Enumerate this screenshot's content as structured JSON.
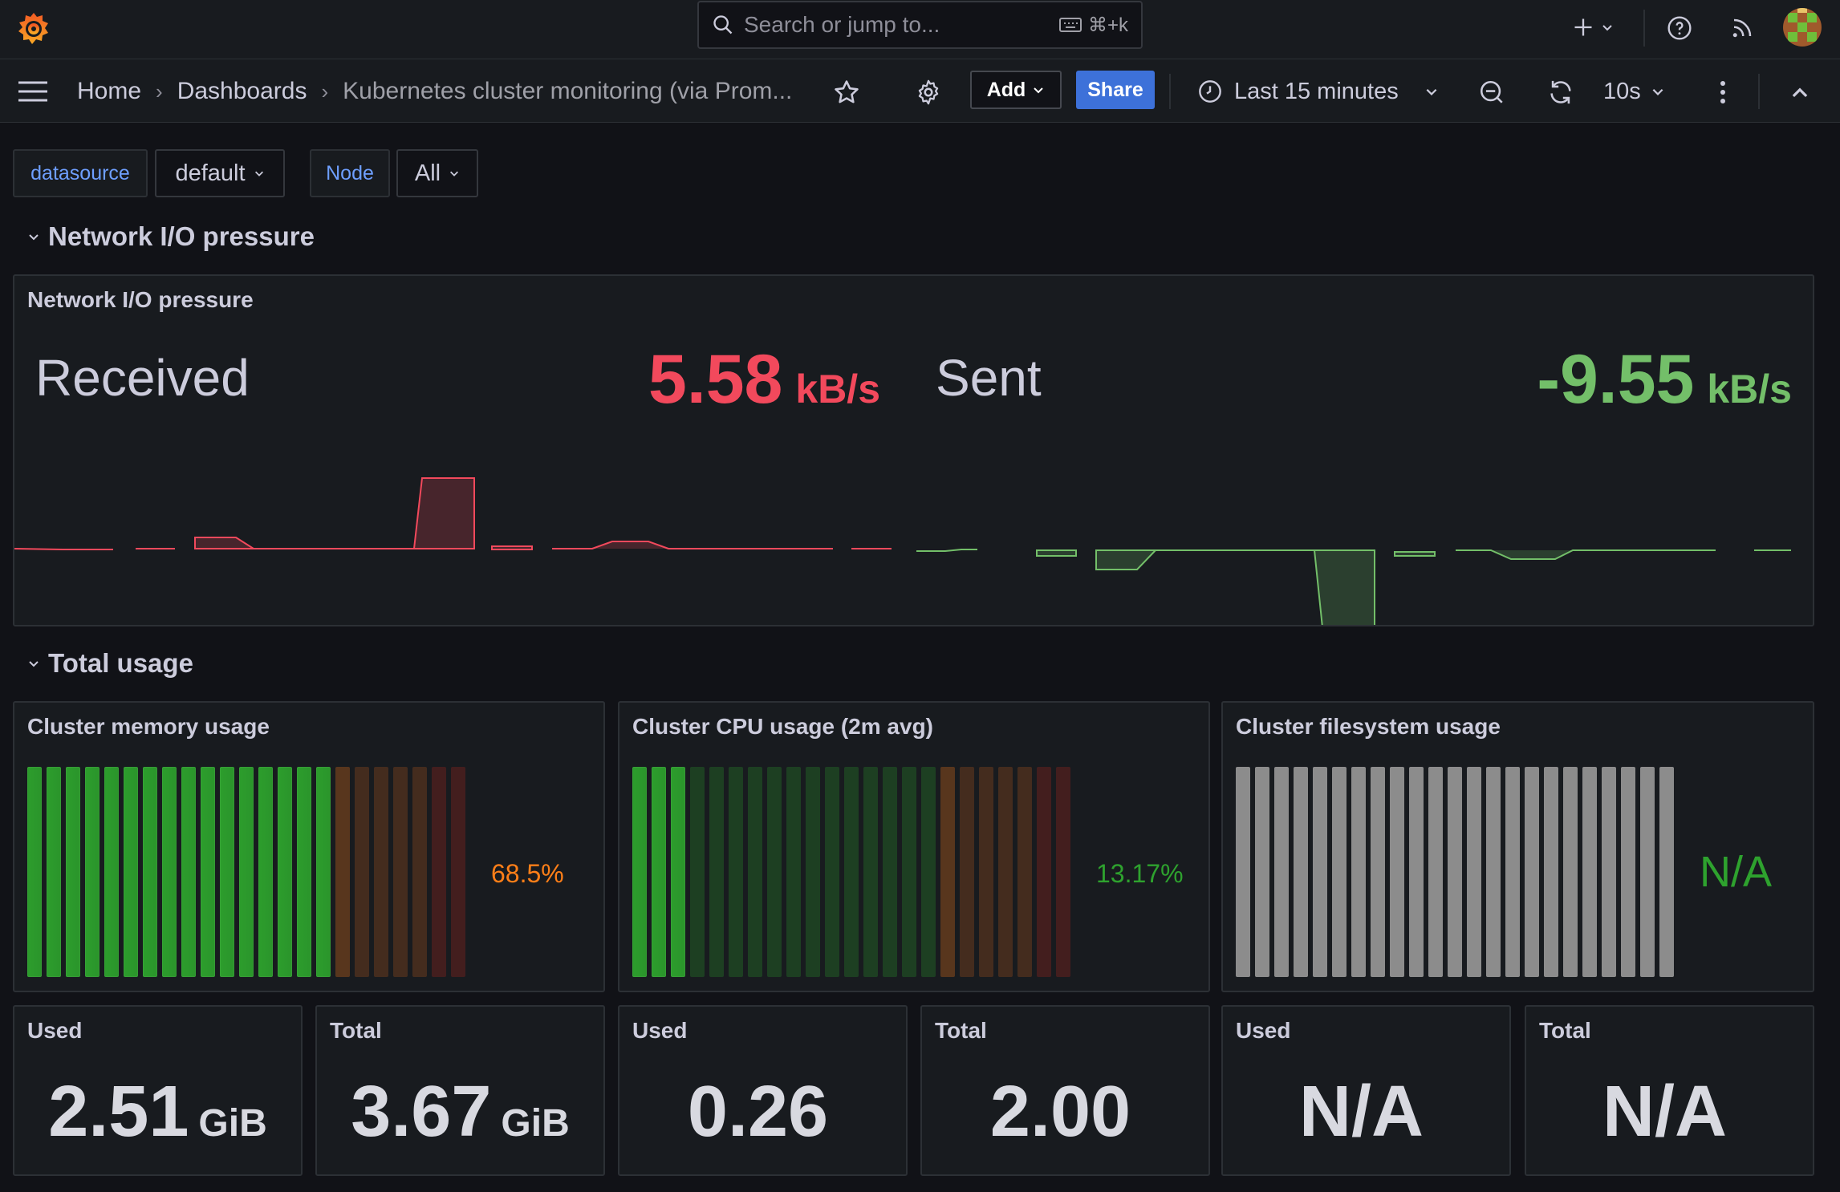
{
  "colors": {
    "received": "#f2495c",
    "sent": "#73bf69",
    "gauge_green": "#2c9d2c",
    "gauge_orange": "#ff7f18",
    "gauge_red": "#b3261e",
    "gauge_gray": "#8c8c8c"
  },
  "topbar": {
    "search_placeholder": "Search or jump to...",
    "shortcut": "⌘+k"
  },
  "breadcrumb": {
    "home": "Home",
    "dashboards": "Dashboards",
    "current": "Kubernetes cluster monitoring (via Prom..."
  },
  "toolbar": {
    "add_label": "Add",
    "share_label": "Share",
    "time_range": "Last 15 minutes",
    "refresh_interval": "10s"
  },
  "variables": [
    {
      "label": "datasource",
      "value": "default"
    },
    {
      "label": "Node",
      "value": "All"
    }
  ],
  "rows": {
    "network": "Network I/O pressure",
    "usage": "Total usage"
  },
  "network_panel": {
    "title": "Network I/O pressure",
    "received": {
      "label": "Received",
      "value": "5.58",
      "unit": "kB/s"
    },
    "sent": {
      "label": "Sent",
      "value": "-9.55",
      "unit": "kB/s"
    }
  },
  "gauges": [
    {
      "title": "Cluster memory usage",
      "value_text": "68.5%",
      "percent": 68.5,
      "color": "#ff7f18"
    },
    {
      "title": "Cluster CPU usage (2m avg)",
      "value_text": "13.17%",
      "percent": 13.17,
      "color": "#2ea22e"
    },
    {
      "title": "Cluster filesystem usage",
      "value_text": "N/A",
      "percent": null,
      "color": "#2ea22e"
    }
  ],
  "stats": [
    {
      "label": "Used",
      "value": "2.51",
      "unit": "GiB"
    },
    {
      "label": "Total",
      "value": "3.67",
      "unit": "GiB"
    },
    {
      "label": "Used",
      "value": "0.26",
      "unit": ""
    },
    {
      "label": "Total",
      "value": "2.00",
      "unit": ""
    },
    {
      "label": "Used",
      "value": "N/A",
      "unit": ""
    },
    {
      "label": "Total",
      "value": "N/A",
      "unit": ""
    }
  ]
}
